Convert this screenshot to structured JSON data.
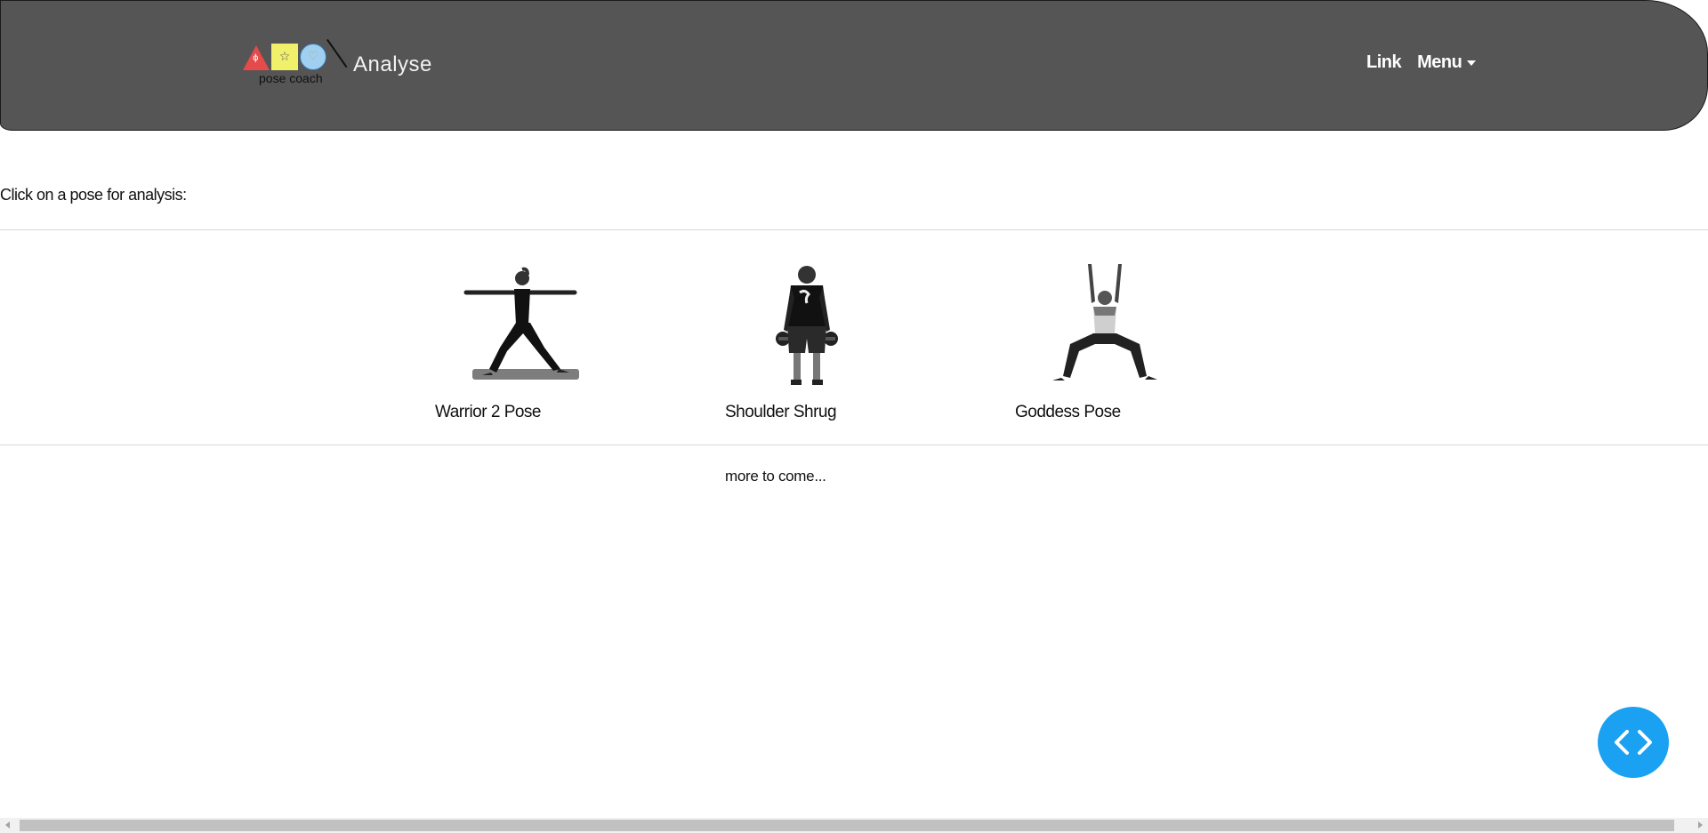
{
  "navbar": {
    "logo_caption": "pose coach",
    "brand_title": "Analyse",
    "links": [
      {
        "label": "Link"
      },
      {
        "label": "Menu"
      }
    ],
    "background_color": "#555555"
  },
  "main": {
    "instruction": "Click on a pose for analysis:",
    "poses": [
      {
        "label": "Warrior 2 Pose",
        "icon": "warrior-2-pose-image"
      },
      {
        "label": "Shoulder Shrug",
        "icon": "shoulder-shrug-image"
      },
      {
        "label": "Goddess Pose",
        "icon": "goddess-pose-image"
      }
    ],
    "more_text": "more to come..."
  },
  "fab": {
    "icon": "code-brackets-icon",
    "color": "#1aa1f2"
  }
}
